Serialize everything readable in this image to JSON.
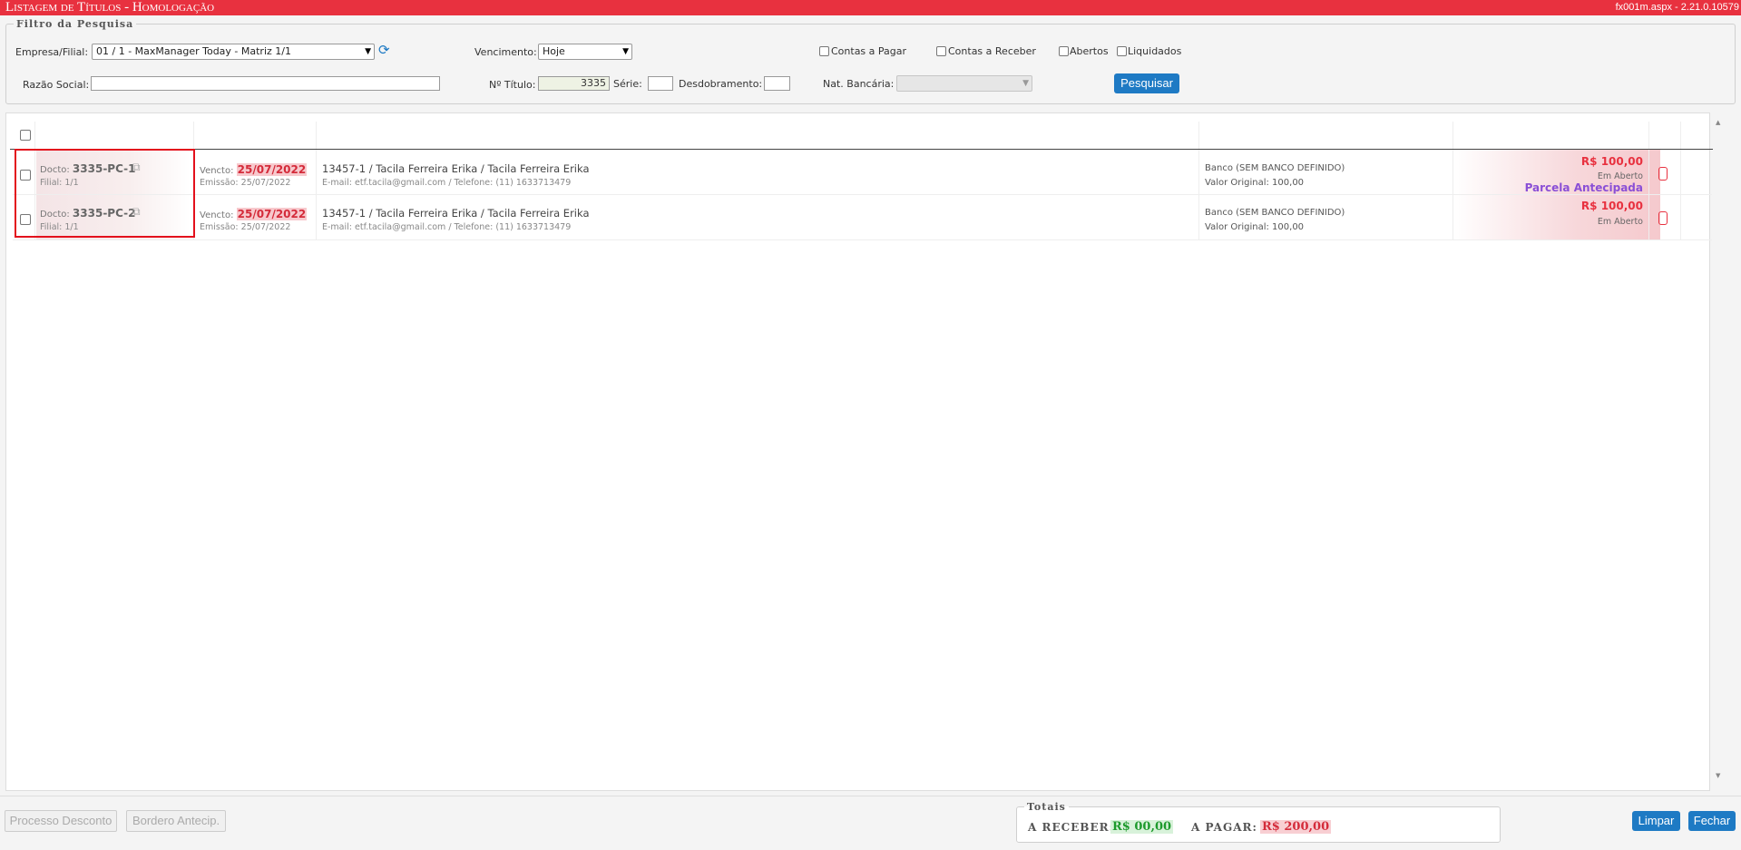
{
  "window": {
    "title": "Listagem de Títulos  - Homologação",
    "version": "fx001m.aspx - 2.21.0.10579"
  },
  "filter": {
    "legend": "Filtro da Pesquisa",
    "empresa_label": "Empresa/Filial:",
    "empresa_value": "01 / 1 - MaxManager Today - Matriz 1/1",
    "vencimento_label": "Vencimento:",
    "vencimento_value": "Hoje",
    "contas_pagar_label": "Contas a Pagar",
    "contas_receber_label": "Contas a Receber",
    "abertos_label": "Abertos",
    "liquidados_label": "Liquidados",
    "razao_social_label": "Razão Social:",
    "razao_social_value": "",
    "titulo_label": "Nº Título:",
    "titulo_value": "3335",
    "serie_label": "Série:",
    "serie_value": "",
    "desdobramento_label": "Desdobramento:",
    "desdobramento_value": "",
    "nat_bancaria_label": "Nat. Bancária:",
    "nat_bancaria_value": "",
    "pesquisar_label": "Pesquisar"
  },
  "rows": [
    {
      "docto_label": "Docto:",
      "docto": "3335-PC-1",
      "filial": "Filial: 1/1",
      "vencto_label": "Vencto:",
      "vencto": "25/07/2022",
      "emissao": "Emissão: 25/07/2022",
      "cliente": "13457-1 / Tacila Ferreira Erika / Tacila Ferreira Erika",
      "contato": "E-mail: etf.tacila@gmail.com / Telefone: (11) 1633713479",
      "banco": "Banco (SEM BANCO DEFINIDO)",
      "valor_original": "Valor Original: 100,00",
      "valor": "R$ 100,00",
      "status": "Em Aberto",
      "tag": "Parcela Antecipada"
    },
    {
      "docto_label": "Docto:",
      "docto": "3335-PC-2",
      "filial": "Filial: 1/1",
      "vencto_label": "Vencto:",
      "vencto": "25/07/2022",
      "emissao": "Emissão: 25/07/2022",
      "cliente": "13457-1 / Tacila Ferreira Erika / Tacila Ferreira Erika",
      "contato": "E-mail: etf.tacila@gmail.com / Telefone: (11) 1633713479",
      "banco": "Banco (SEM BANCO DEFINIDO)",
      "valor_original": "Valor Original: 100,00",
      "valor": "R$ 100,00",
      "status": "Em Aberto",
      "tag": ""
    }
  ],
  "footer": {
    "processo_desconto": "Processo Desconto",
    "bordero_antecip": "Bordero Antecip.",
    "totais_legend": "Totais",
    "a_receber_label": "A RECEBER:",
    "a_receber_value": "R$ 00,00",
    "a_pagar_label": "A PAGAR:",
    "a_pagar_value": "R$ 200,00",
    "limpar": "Limpar",
    "fechar": "Fechar"
  },
  "colors": {
    "titlebar": "#e8313f",
    "accent_blue": "#1e7ac4",
    "due_red": "#d42b3a",
    "receivable_green": "#1d9a2c",
    "antecipada_purple": "#8a4fd6"
  }
}
